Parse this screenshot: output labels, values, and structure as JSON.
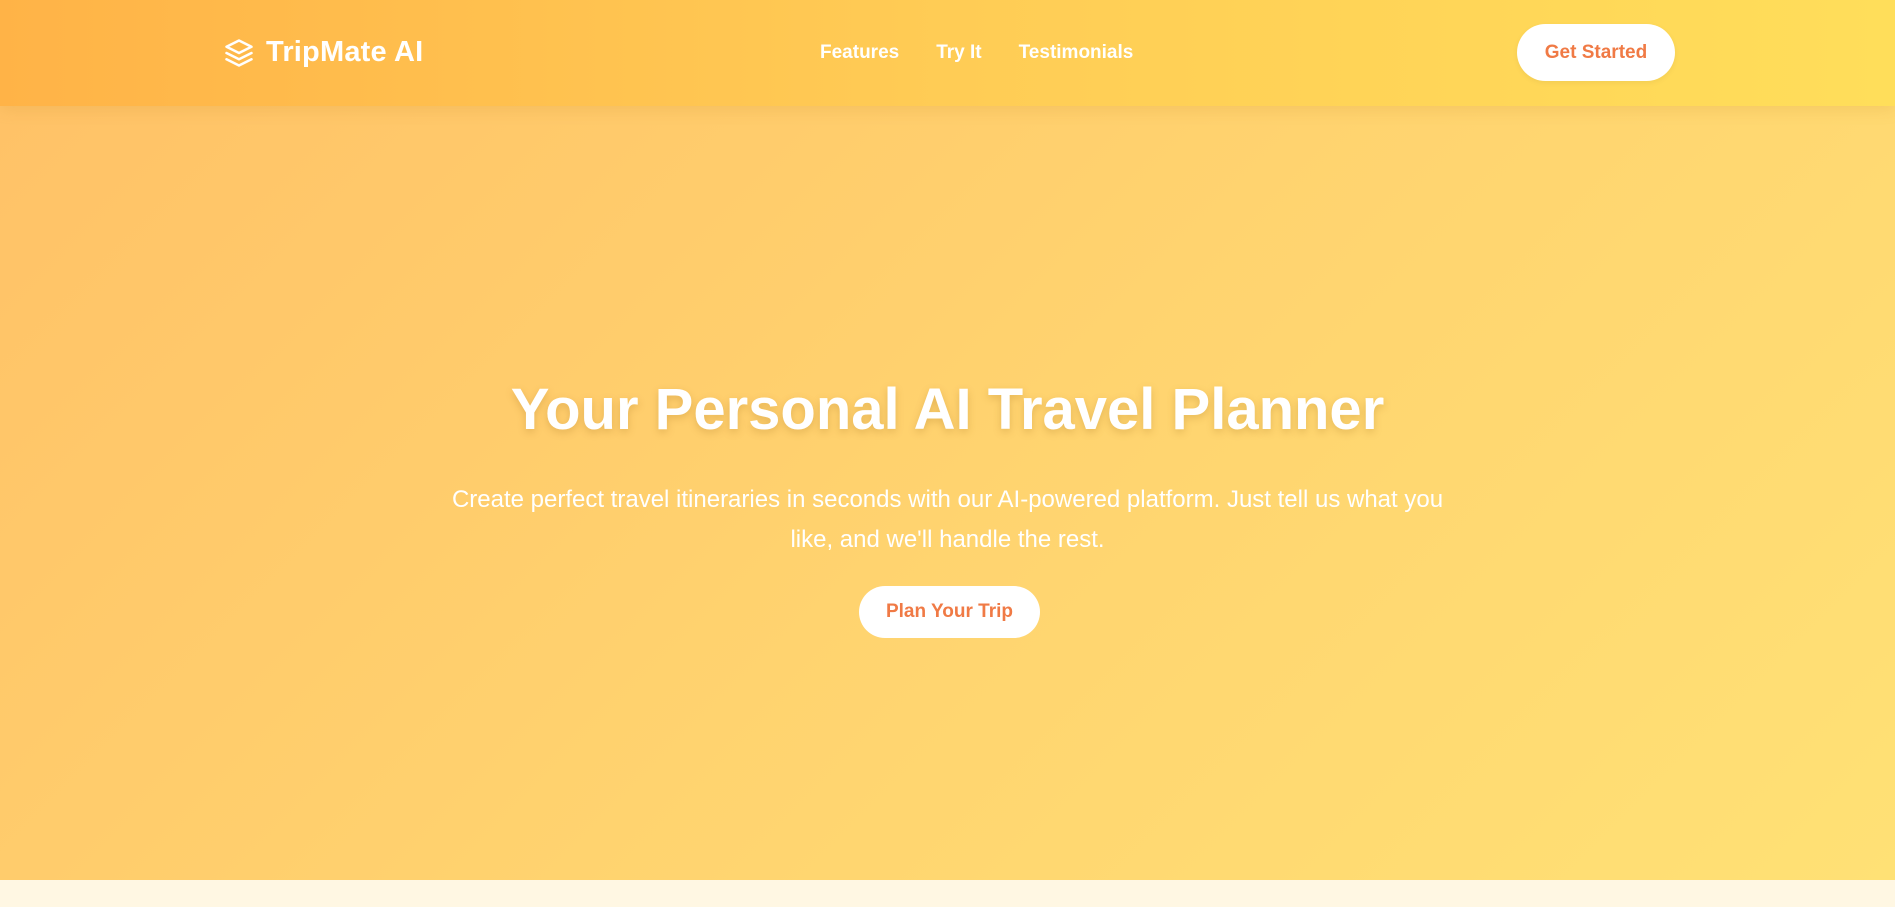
{
  "header": {
    "brand_name": "TripMate AI",
    "brand_icon": "layers-icon",
    "nav": [
      {
        "label": "Features"
      },
      {
        "label": "Try It"
      },
      {
        "label": "Testimonials"
      }
    ],
    "cta_label": "Get Started"
  },
  "hero": {
    "title": "Your Personal AI Travel Planner",
    "subtitle": "Create perfect travel itineraries in seconds with our AI-powered platform. Just tell us what you like, and we'll handle the rest.",
    "cta_label": "Plan Your Trip"
  },
  "colors": {
    "header_gradient_start": "#ffb347",
    "header_gradient_end": "#ffde5a",
    "hero_gradient_start": "#ffc267",
    "hero_gradient_end": "#ffe175",
    "button_text": "#f07a45",
    "button_bg": "#ffffff"
  }
}
